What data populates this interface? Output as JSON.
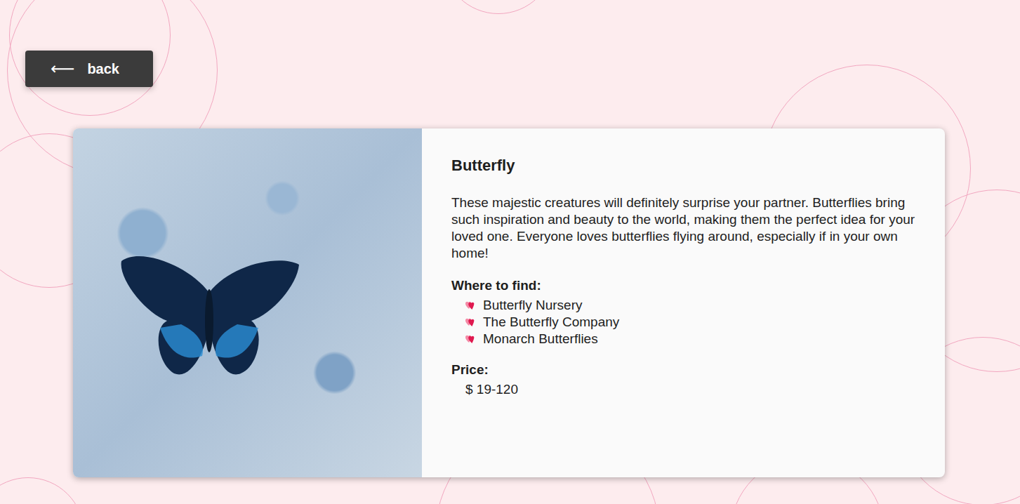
{
  "back_button": {
    "icon": "⟵",
    "label": "back"
  },
  "product": {
    "title": "Butterfly",
    "description": "These majestic creatures will definitely surprise your partner. Butterflies bring such inspiration and beauty to the world, making them the perfect idea for your loved one. Everyone loves butterflies flying around, especially if in your own home!",
    "where_to_find": {
      "label": "Where to find:",
      "items": [
        "Butterfly Nursery",
        "The Butterfly Company",
        "Monarch Butterflies"
      ]
    },
    "price": {
      "label": "Price:",
      "value": "$ 19-120"
    }
  }
}
